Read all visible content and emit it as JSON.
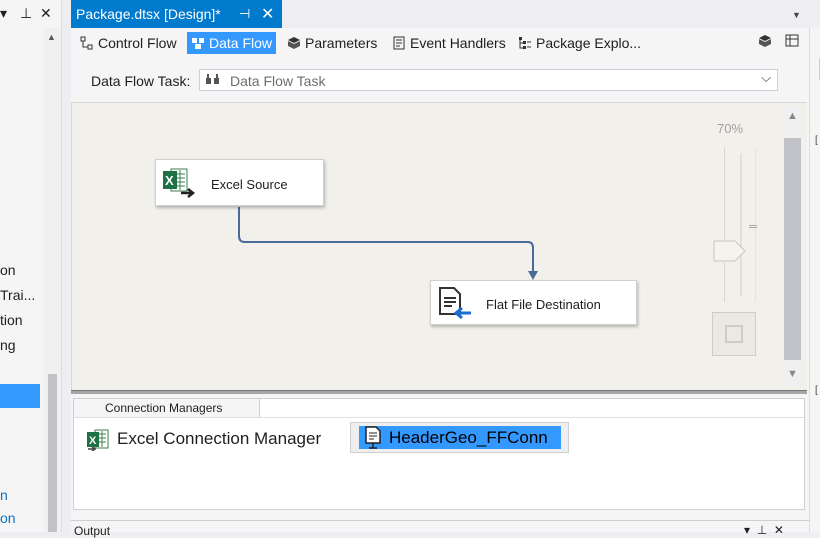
{
  "left_panel": {
    "fragments": [
      "on",
      "Trai...",
      "tion",
      "ng",
      "n",
      "on"
    ],
    "pin_icon": "pin-icon",
    "close_icon": "close-icon"
  },
  "document_tab": {
    "title": "Package.dtsx [Design]*",
    "pin_glyph": "⊣",
    "close_glyph": "✕"
  },
  "designer_tabs": [
    {
      "label": "Control Flow",
      "icon": "control-flow-icon",
      "active": false
    },
    {
      "label": "Data Flow",
      "icon": "data-flow-icon",
      "active": true
    },
    {
      "label": "Parameters",
      "icon": "parameters-icon",
      "active": false
    },
    {
      "label": "Event Handlers",
      "icon": "event-handlers-icon",
      "active": false
    },
    {
      "label": "Package Explo...",
      "icon": "package-explorer-icon",
      "active": false
    }
  ],
  "task_selector": {
    "label": "Data Flow Task:",
    "value": "Data Flow Task"
  },
  "zoom": {
    "label": "70%",
    "level_percent": 70
  },
  "nodes": {
    "excel_source": {
      "label": "Excel Source",
      "icon": "excel-source-icon"
    },
    "flat_file_destination": {
      "label": "Flat File Destination",
      "icon": "flat-file-destination-icon"
    }
  },
  "connection_managers": {
    "tab_label": "Connection Managers",
    "items": [
      {
        "label": "Excel Connection Manager",
        "icon": "excel-connection-icon",
        "selected": false
      },
      {
        "label": "HeaderGeo_FFConn",
        "icon": "flat-file-connection-icon",
        "selected": true
      }
    ]
  },
  "bottom_panel": {
    "title_fragment": "Output"
  },
  "colors": {
    "accent": "#007acc",
    "selection": "#3399ff",
    "canvas": "#f2f0ea",
    "path": "#4a6a9a"
  }
}
